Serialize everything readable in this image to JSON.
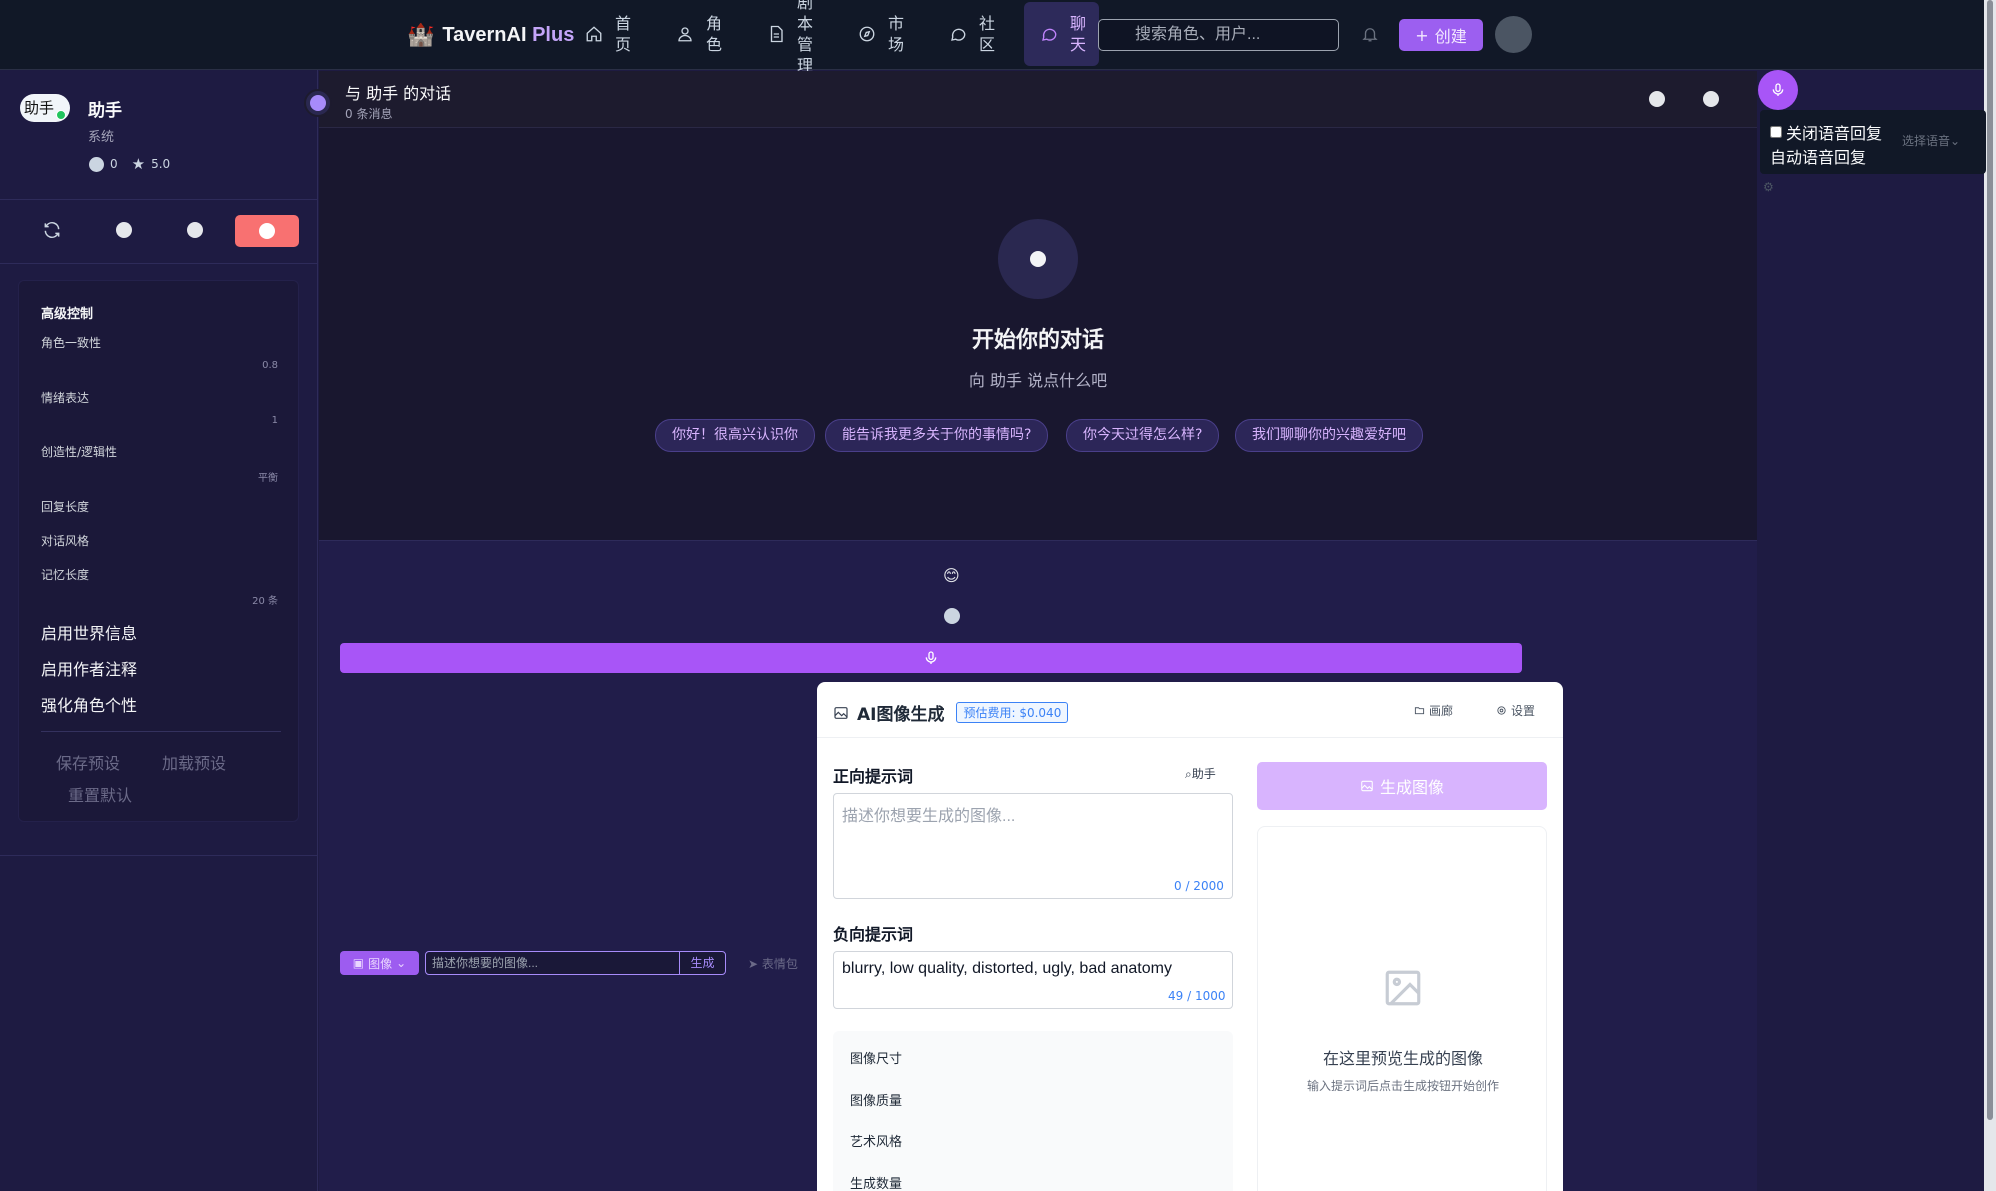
{
  "app": {
    "brand_logo": "🏰",
    "brand_name": "TavernAI",
    "brand_plus": "Plus"
  },
  "nav": {
    "items": [
      {
        "icon": "home-icon",
        "label_lines": [
          "首",
          "页"
        ]
      },
      {
        "icon": "user-icon",
        "label_lines": [
          "角",
          "色"
        ]
      },
      {
        "icon": "document-icon",
        "label_lines": [
          "剧",
          "本",
          "管",
          "理"
        ]
      },
      {
        "icon": "compass-icon",
        "label_lines": [
          "市",
          "场"
        ]
      },
      {
        "icon": "message-icon",
        "label_lines": [
          "社",
          "区"
        ]
      },
      {
        "icon": "chat-icon",
        "label_lines": [
          "聊",
          "天"
        ],
        "active": true
      }
    ],
    "search_placeholder": "搜索角色、用户...",
    "create_label": "创建"
  },
  "character": {
    "avatar_alt": "助手",
    "name": "助手",
    "subtitle": "系统",
    "chat_count": "0",
    "rating": "5.0"
  },
  "controls": {
    "title": "高级控制",
    "items": [
      {
        "label": "角色一致性",
        "value": "0.8"
      },
      {
        "label": "情绪表达",
        "value": "1"
      },
      {
        "label": "创造性/逻辑性",
        "value": "平衡"
      },
      {
        "label": "回复长度",
        "value": ""
      },
      {
        "label": "对话风格",
        "value": ""
      },
      {
        "label": "记忆长度",
        "value": "20 条"
      }
    ],
    "toggles": [
      "启用世界信息",
      "启用作者注释",
      "强化角色个性"
    ],
    "save_preset": "保存预设",
    "load_preset": "加载预设",
    "reset_default": "重置默认"
  },
  "chat": {
    "title": "与 助手 的对话",
    "message_count": "0 条消息",
    "empty_title": "开始你的对话",
    "empty_sub": "向 助手 说点什么吧",
    "suggestions": [
      "你好！很高兴认识你",
      "能告诉我更多关于你的事情吗?",
      "你今天过得怎么样?",
      "我们聊聊你的兴趣爱好吧"
    ]
  },
  "input": {
    "emoji": "😊",
    "image_tag": "图像",
    "image_placeholder": "描述你想要的图像...",
    "image_generate": "生成",
    "emoji_pack": "表情包"
  },
  "ai_image": {
    "title": "AI图像生成",
    "cost_badge": "预估费用: $0.040",
    "gallery": "画廊",
    "settings": "设置",
    "positive_label": "正向提示词",
    "helper": "助手",
    "positive_placeholder": "描述你想要生成的图像...",
    "positive_count": "0 / 2000",
    "negative_label": "负向提示词",
    "negative_value": "blurry, low quality, distorted, ugly, bad anatomy",
    "negative_count": "49 / 1000",
    "options": [
      "图像尺寸",
      "图像质量",
      "艺术风格",
      "生成数量"
    ],
    "generate_button": "生成图像",
    "preview_title": "在这里预览生成的图像",
    "preview_sub": "输入提示词后点击生成按钮开始创作"
  },
  "voice": {
    "close_reply": "关闭语音回复",
    "auto_reply": "自动语音回复",
    "select_voice": "选择语音"
  }
}
